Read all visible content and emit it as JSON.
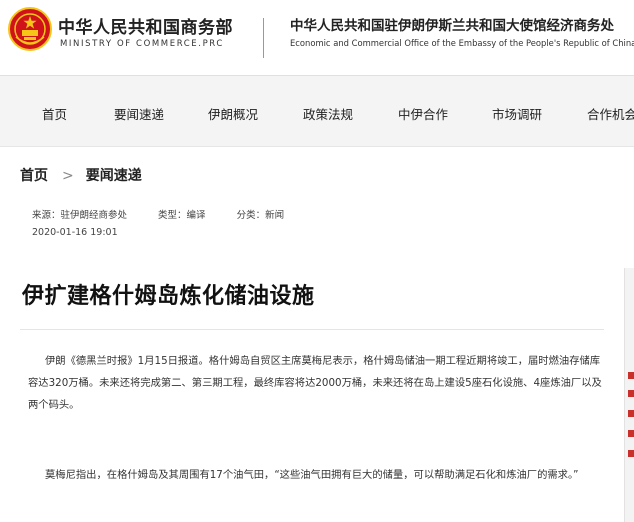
{
  "header": {
    "emblem_icon": "national-emblem-icon",
    "ministry_cn": "中华人民共和国商务部",
    "ministry_en": "MINISTRY OF COMMERCE.PRC",
    "embassy_cn": "中华人民共和国驻伊朗伊斯兰共和国大使馆经济商务处",
    "embassy_en": "Economic and Commercial Office of the Embassy of the People's Republic of China in"
  },
  "nav": {
    "items": [
      "首页",
      "要闻速递",
      "伊朗概况",
      "政策法规",
      "中伊合作",
      "市场调研",
      "合作机会"
    ]
  },
  "breadcrumb": {
    "home": "首页",
    "separator": ">",
    "current": "要闻速递"
  },
  "article": {
    "source": "来源：驻伊朗经商参处",
    "type": "类型：编译",
    "category": "分类：新闻",
    "date": "2020-01-16 19:01",
    "title": "伊扩建格什姆岛炼化储油设施",
    "paragraphs": [
      "伊朗《德黑兰时报》1月15日报道。格什姆岛自贸区主席莫梅尼表示，格什姆岛储油一期工程近期将竣工，届时燃油存储库容达320万桶。未来还将完成第二、第三期工程，最终库容将达2000万桶，未来还将在岛上建设5座石化设施、4座炼油厂以及两个码头。",
      "莫梅尼指出，在格什姆岛及其周围有17个油气田，“这些油气田拥有巨大的储量，可以帮助满足石化和炼油厂的需求。”"
    ]
  },
  "colors": {
    "nav_background": "#f4f4f4",
    "side_accent": "#c9302c",
    "emblem_red": "#d0121b",
    "emblem_gold": "#f5c518"
  }
}
